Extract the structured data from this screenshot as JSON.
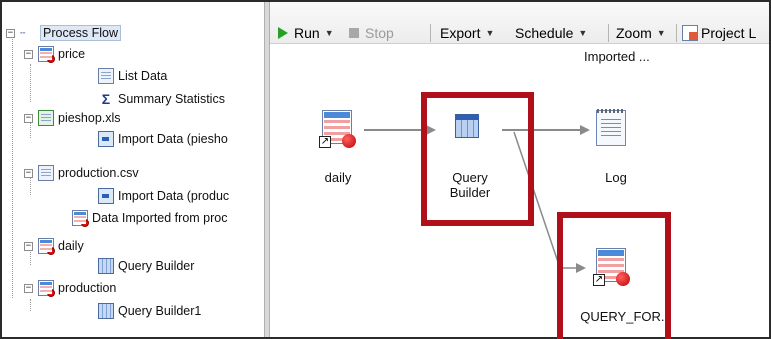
{
  "tree": {
    "root_label": "Process Flow",
    "items": [
      {
        "label": "price"
      },
      {
        "label": "List Data"
      },
      {
        "label": "Summary Statistics"
      },
      {
        "label": "pieshop.xls"
      },
      {
        "label": "Import Data (piesho"
      },
      {
        "label": "production.csv"
      },
      {
        "label": "Import Data (produc"
      },
      {
        "label": "Data Imported from proc"
      },
      {
        "label": "daily"
      },
      {
        "label": "Query Builder"
      },
      {
        "label": "production"
      },
      {
        "label": "Query Builder1"
      }
    ],
    "expander_minus": "−"
  },
  "toolbar": {
    "run_label": "Run",
    "stop_label": "Stop",
    "export_label": "Export",
    "schedule_label": "Schedule",
    "zoom_label": "Zoom",
    "project_label": "Project L",
    "caret": "▼"
  },
  "canvas": {
    "imported_text": "Imported ...",
    "nodes": {
      "daily": "daily",
      "query_builder_line1": "Query",
      "query_builder_line2": "Builder",
      "log": "Log",
      "query_for": "QUERY_FOR..."
    },
    "shortcut_glyph": "↗"
  },
  "colors": {
    "highlight_box": "#b0101a",
    "connector": "#8a8a8a",
    "run_green": "#25a025"
  }
}
